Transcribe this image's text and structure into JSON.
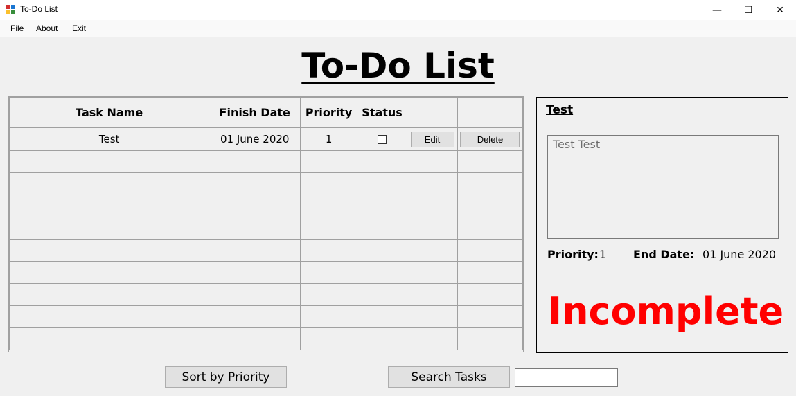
{
  "window": {
    "title": "To-Do List",
    "minimize": "—",
    "maximize": "☐",
    "close": "✕"
  },
  "menu": {
    "file": "File",
    "about": "About",
    "exit": "Exit"
  },
  "heading": "To-Do List",
  "grid": {
    "columns": [
      "Task Name",
      "Finish Date",
      "Priority",
      "Status",
      "",
      ""
    ],
    "rows": [
      {
        "name": "Test",
        "date": "01 June 2020",
        "priority": "1",
        "status_checked": false,
        "edit": "Edit",
        "delete": "Delete"
      }
    ]
  },
  "detail": {
    "title": "Test",
    "description": "Test Test",
    "priority_label": "Priority:",
    "priority_value": "1",
    "end_date_label": "End Date:",
    "end_date_value": "01 June 2020",
    "status": "Incomplete",
    "status_color": "#ff0000"
  },
  "actions": {
    "sort": "Sort by Priority",
    "search": "Search Tasks",
    "search_value": ""
  }
}
